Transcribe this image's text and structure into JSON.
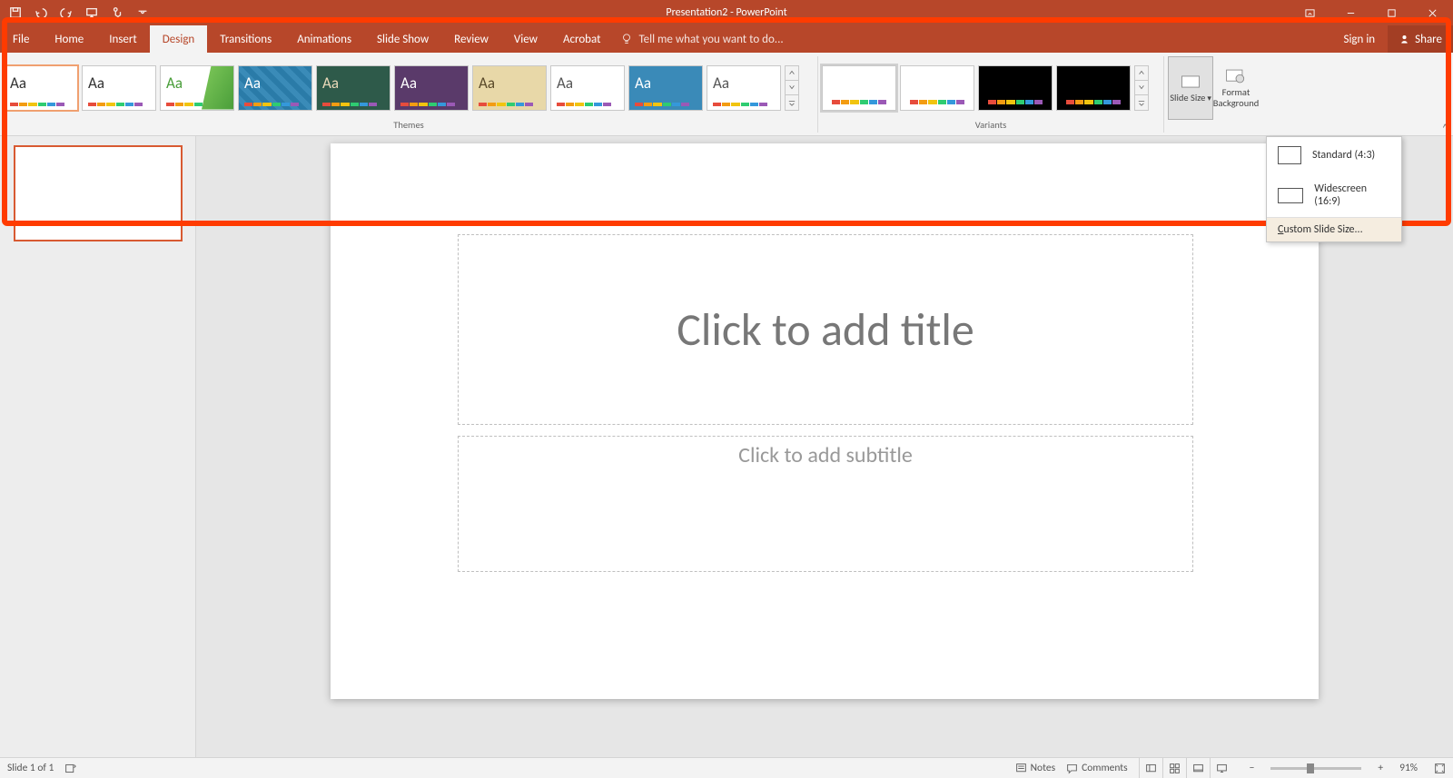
{
  "title": "Presentation2 - PowerPoint",
  "qat": {
    "save": "save",
    "undo": "undo",
    "redo": "redo",
    "start": "start-from-beginning",
    "touch": "touch-mode"
  },
  "tabs": {
    "file": "File",
    "home": "Home",
    "insert": "Insert",
    "design": "Design",
    "transitions": "Transitions",
    "animations": "Animations",
    "slideshow": "Slide Show",
    "review": "Review",
    "view": "View",
    "acrobat": "Acrobat"
  },
  "tellme": "Tell me what you want to do...",
  "signin": "Sign in",
  "share": "Share",
  "groups": {
    "themes": "Themes",
    "variants": "Variants"
  },
  "customize": {
    "slidesize": "Slide Size",
    "formatbg": "Format Background"
  },
  "dropdown": {
    "standard": "Standard (4:3)",
    "widescreen": "Widescreen (16:9)",
    "custom": "Custom Slide Size...",
    "custom_accel": "C"
  },
  "placeholders": {
    "title": "Click to add title",
    "subtitle": "Click to add subtitle"
  },
  "status": {
    "slide": "Slide 1 of 1",
    "notes": "Notes",
    "comments": "Comments",
    "zoom": "91%"
  },
  "themes": [
    {
      "bg": "#ffffff",
      "fg": "#333",
      "aa": "Aa"
    },
    {
      "bg": "#ffffff",
      "fg": "#333",
      "aa": "Aa"
    },
    {
      "bg": "#ffffff",
      "fg": "#4a9e3a",
      "aa": "Aa",
      "extra": "green-swoosh"
    },
    {
      "bg": "#2a7ba8",
      "fg": "#fff",
      "aa": "Aa",
      "pattern": "diamond"
    },
    {
      "bg": "#2e5a4a",
      "fg": "#e8d8b8",
      "aa": "Aa"
    },
    {
      "bg": "#5a3a6a",
      "fg": "#fff",
      "aa": "Aa"
    },
    {
      "bg": "#e8d8a8",
      "fg": "#5a4a2a",
      "aa": "Aa"
    },
    {
      "bg": "#ffffff",
      "fg": "#555",
      "aa": "Aa"
    },
    {
      "bg": "#3a8ab8",
      "fg": "#fff",
      "aa": "Aa"
    },
    {
      "bg": "#ffffff",
      "fg": "#555",
      "aa": "Aa"
    }
  ],
  "variants": [
    {
      "bg": "#ffffff"
    },
    {
      "bg": "#ffffff"
    },
    {
      "bg": "#000000"
    },
    {
      "bg": "#000000"
    }
  ],
  "palette": [
    "#e74c3c",
    "#f39c12",
    "#f1c40f",
    "#2ecc71",
    "#3498db",
    "#9b59b6"
  ]
}
